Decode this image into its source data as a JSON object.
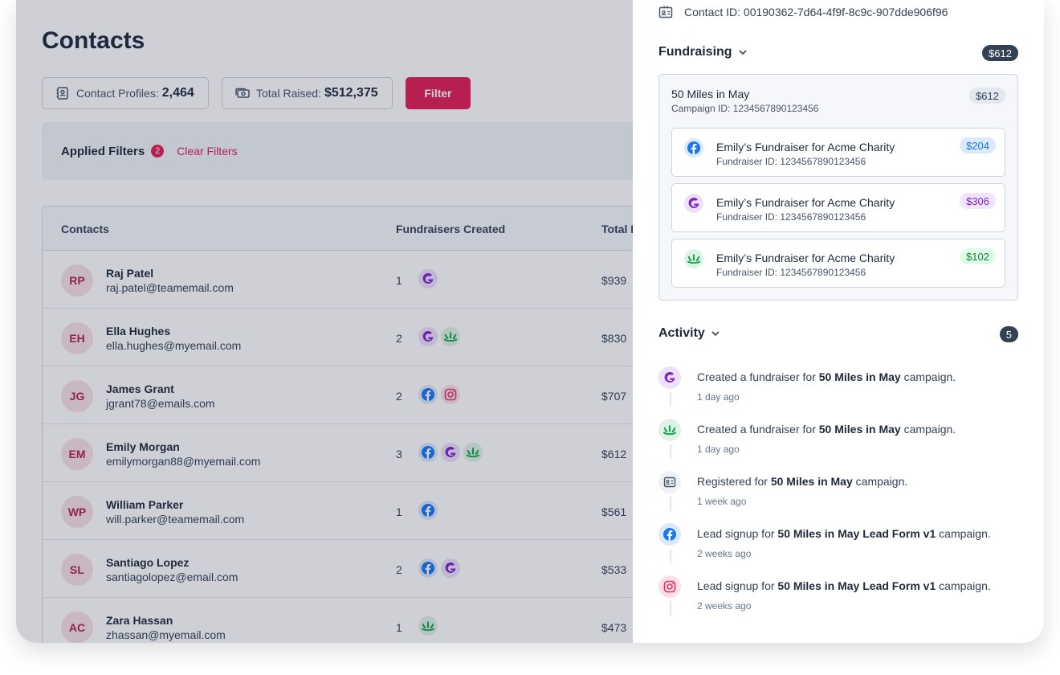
{
  "page_title": "Contacts",
  "stats": {
    "profiles_label": "Contact Profiles:",
    "profiles_value": "2,464",
    "raised_label": "Total Raised:",
    "raised_value": "$512,375"
  },
  "filter_button": "Filter",
  "applied_filters": {
    "label": "Applied Filters",
    "count": "2",
    "clear": "Clear Filters"
  },
  "table": {
    "headers": [
      "Contacts",
      "Fundraisers Created",
      "Total R"
    ],
    "rows": [
      {
        "initials": "RP",
        "name": "Raj Patel",
        "email": "raj.patel@teamemail.com",
        "count": "1",
        "platforms": [
          "gofundme"
        ],
        "total": "$939"
      },
      {
        "initials": "EH",
        "name": "Ella Hughes",
        "email": "ella.hughes@myemail.com",
        "count": "2",
        "platforms": [
          "gofundme",
          "greenleaf"
        ],
        "total": "$830"
      },
      {
        "initials": "JG",
        "name": "James Grant",
        "email": "jgrant78@emails.com",
        "count": "2",
        "platforms": [
          "facebook",
          "instagram"
        ],
        "total": "$707"
      },
      {
        "initials": "EM",
        "name": "Emily Morgan",
        "email": "emilymorgan88@myemail.com",
        "count": "3",
        "platforms": [
          "facebook",
          "gofundme",
          "greenleaf"
        ],
        "total": "$612"
      },
      {
        "initials": "WP",
        "name": "William Parker",
        "email": "will.parker@teamemail.com",
        "count": "1",
        "platforms": [
          "facebook"
        ],
        "total": "$561"
      },
      {
        "initials": "SL",
        "name": "Santiago Lopez",
        "email": "santiagolopez@email.com",
        "count": "2",
        "platforms": [
          "facebook",
          "gofundme"
        ],
        "total": "$533"
      },
      {
        "initials": "AC",
        "name": "Zara Hassan",
        "email": "zhassan@myemail.com",
        "count": "1",
        "platforms": [
          "greenleaf"
        ],
        "total": "$473"
      }
    ]
  },
  "panel": {
    "contact_id": "Contact ID: 00190362-7d64-4f9f-8c9c-907dde906f96",
    "fundraising_label": "Fundraising",
    "fundraising_total": "$612",
    "campaign": {
      "name": "50 Miles in May",
      "id": "Campaign ID: 1234567890123456",
      "amount": "$612",
      "fundraisers": [
        {
          "platform": "facebook",
          "name": "Emily’s Fundraiser for Acme Charity",
          "id": "Fundraiser ID: 1234567890123456",
          "amount": "$204"
        },
        {
          "platform": "gofundme",
          "name": "Emily’s Fundraiser for Acme Charity",
          "id": "Fundraiser ID: 1234567890123456",
          "amount": "$306"
        },
        {
          "platform": "greenleaf",
          "name": "Emily’s Fundraiser for Acme Charity",
          "id": "Fundraiser ID: 1234567890123456",
          "amount": "$102"
        }
      ]
    },
    "activity_label": "Activity",
    "activity_count": "5",
    "activities": [
      {
        "icon": "gofundme",
        "prefix": "Created a fundraiser for ",
        "bold": "50 Miles in May",
        "suffix": " campaign.",
        "time": "1 day ago"
      },
      {
        "icon": "greenleaf",
        "prefix": "Created a fundraiser for ",
        "bold": "50 Miles in May",
        "suffix": " campaign.",
        "time": "1 day ago"
      },
      {
        "icon": "form",
        "prefix": "Registered for ",
        "bold": "50 Miles in May",
        "suffix": " campaign.",
        "time": "1 week ago"
      },
      {
        "icon": "facebook",
        "prefix": "Lead signup for ",
        "bold": "50 Miles in May Lead Form v1",
        "suffix": " campaign.",
        "time": "2 weeks ago"
      },
      {
        "icon": "instagram",
        "prefix": "Lead signup for ",
        "bold": "50 Miles in May Lead Form v1",
        "suffix": " campaign.",
        "time": "2 weeks ago"
      }
    ]
  },
  "colors": {
    "accent": "#e11d54",
    "dark_badge": "#334155",
    "facebook": "#1877f2",
    "gofundme": "#7e22ce",
    "greenleaf": "#16a34a",
    "instagram": "#e1306c"
  }
}
